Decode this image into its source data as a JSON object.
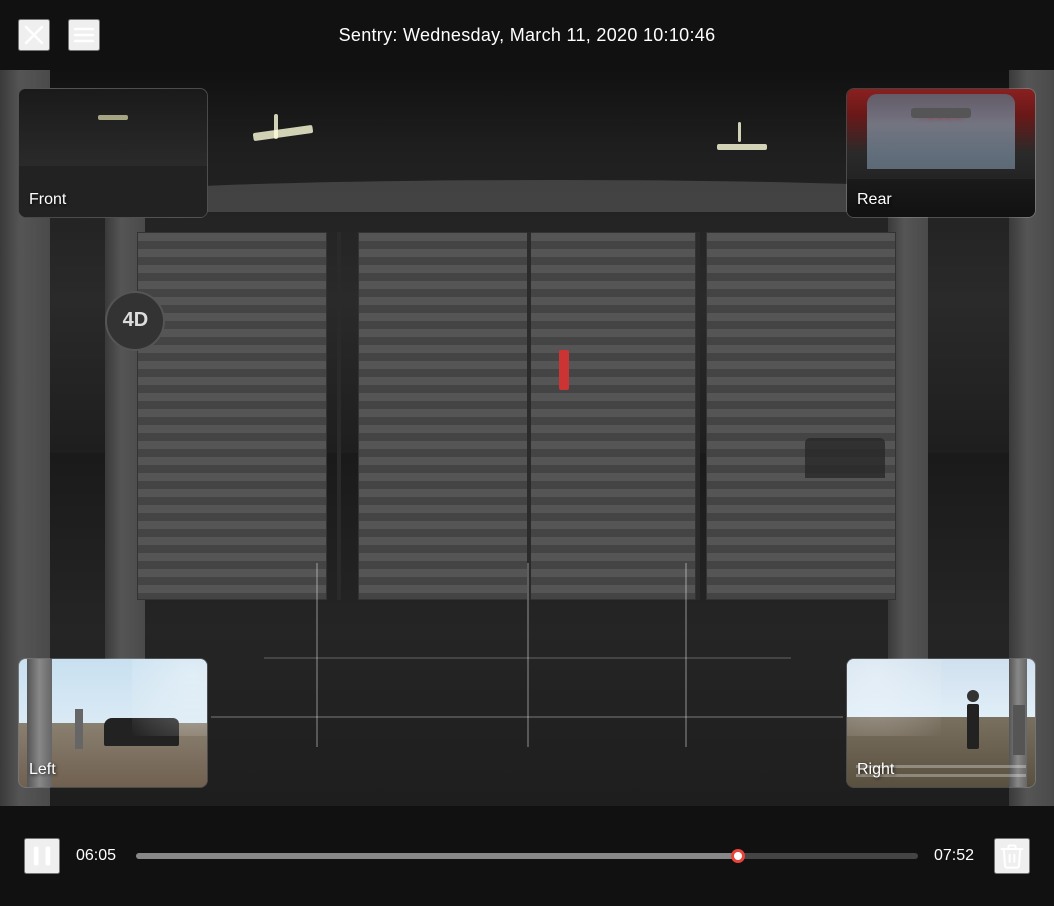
{
  "header": {
    "title": "Sentry: Wednesday, March 11, 2020 10:10:46",
    "close_icon": "×",
    "menu_icon": "≡"
  },
  "cameras": {
    "front": {
      "label": "Front",
      "position": "top-left"
    },
    "rear": {
      "label": "Rear",
      "position": "top-right"
    },
    "left": {
      "label": "Left",
      "position": "bottom-left"
    },
    "right": {
      "label": "Right",
      "position": "bottom-right"
    }
  },
  "controls": {
    "play_pause_state": "playing",
    "current_time": "06:05",
    "total_time": "07:52",
    "progress_percent": 77,
    "progress_dot_left": "77%"
  },
  "icons": {
    "close": "close-icon",
    "menu": "menu-icon",
    "pause": "pause-icon",
    "delete": "trash-icon"
  }
}
